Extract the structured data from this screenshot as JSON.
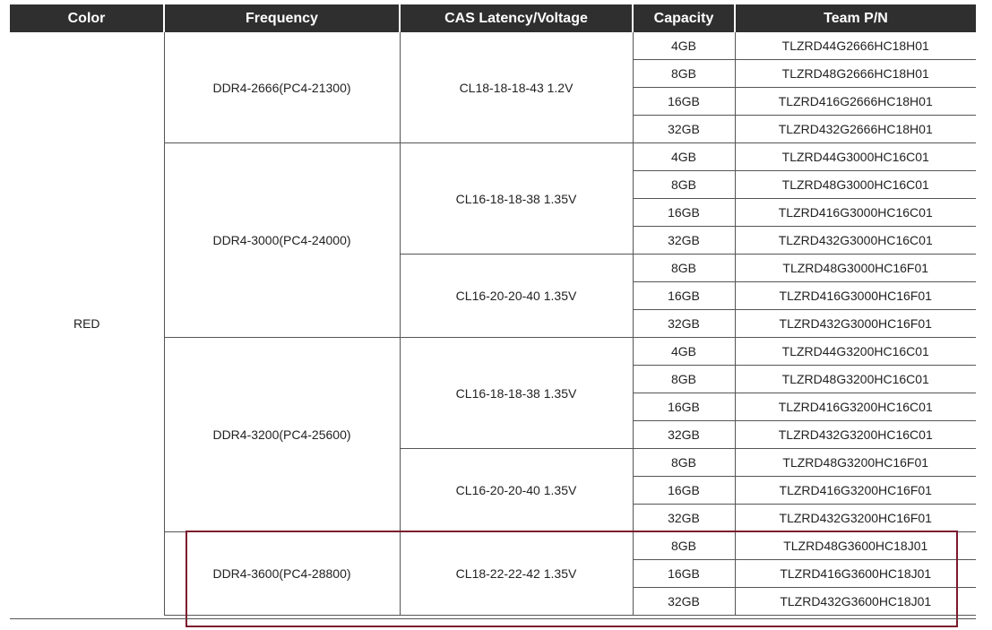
{
  "headers": {
    "color": "Color",
    "frequency": "Frequency",
    "cas": "CAS Latency/Voltage",
    "capacity": "Capacity",
    "pn": "Team P/N"
  },
  "color": "RED",
  "groups": [
    {
      "frequency": "DDR4-2666(PC4-21300)",
      "cas_groups": [
        {
          "cas": "CL18-18-18-43 1.2V",
          "rows": [
            {
              "capacity": "4GB",
              "pn": "TLZRD44G2666HC18H01"
            },
            {
              "capacity": "8GB",
              "pn": "TLZRD48G2666HC18H01"
            },
            {
              "capacity": "16GB",
              "pn": "TLZRD416G2666HC18H01"
            },
            {
              "capacity": "32GB",
              "pn": "TLZRD432G2666HC18H01"
            }
          ]
        }
      ]
    },
    {
      "frequency": "DDR4-3000(PC4-24000)",
      "cas_groups": [
        {
          "cas": "CL16-18-18-38 1.35V",
          "rows": [
            {
              "capacity": "4GB",
              "pn": "TLZRD44G3000HC16C01"
            },
            {
              "capacity": "8GB",
              "pn": "TLZRD48G3000HC16C01"
            },
            {
              "capacity": "16GB",
              "pn": "TLZRD416G3000HC16C01"
            },
            {
              "capacity": "32GB",
              "pn": "TLZRD432G3000HC16C01"
            }
          ]
        },
        {
          "cas": "CL16-20-20-40 1.35V",
          "rows": [
            {
              "capacity": "8GB",
              "pn": "TLZRD48G3000HC16F01"
            },
            {
              "capacity": "16GB",
              "pn": "TLZRD416G3000HC16F01"
            },
            {
              "capacity": "32GB",
              "pn": "TLZRD432G3000HC16F01"
            }
          ]
        }
      ]
    },
    {
      "frequency": "DDR4-3200(PC4-25600)",
      "cas_groups": [
        {
          "cas": "CL16-18-18-38 1.35V",
          "rows": [
            {
              "capacity": "4GB",
              "pn": "TLZRD44G3200HC16C01"
            },
            {
              "capacity": "8GB",
              "pn": "TLZRD48G3200HC16C01"
            },
            {
              "capacity": "16GB",
              "pn": "TLZRD416G3200HC16C01"
            },
            {
              "capacity": "32GB",
              "pn": "TLZRD432G3200HC16C01"
            }
          ]
        },
        {
          "cas": "CL16-20-20-40 1.35V",
          "rows": [
            {
              "capacity": "8GB",
              "pn": "TLZRD48G3200HC16F01"
            },
            {
              "capacity": "16GB",
              "pn": "TLZRD416G3200HC16F01"
            },
            {
              "capacity": "32GB",
              "pn": "TLZRD432G3200HC16F01"
            }
          ]
        }
      ]
    },
    {
      "frequency": "DDR4-3600(PC4-28800)",
      "highlighted": true,
      "cas_groups": [
        {
          "cas": "CL18-22-22-42  1.35V",
          "rows": [
            {
              "capacity": "8GB",
              "pn": "TLZRD48G3600HC18J01"
            },
            {
              "capacity": "16GB",
              "pn": "TLZRD416G3600HC18J01"
            },
            {
              "capacity": "32GB",
              "pn": "TLZRD432G3600HC18J01"
            }
          ]
        }
      ]
    }
  ],
  "highlight_color": "#7b1a2e",
  "header_bg": "#2f2f2f"
}
